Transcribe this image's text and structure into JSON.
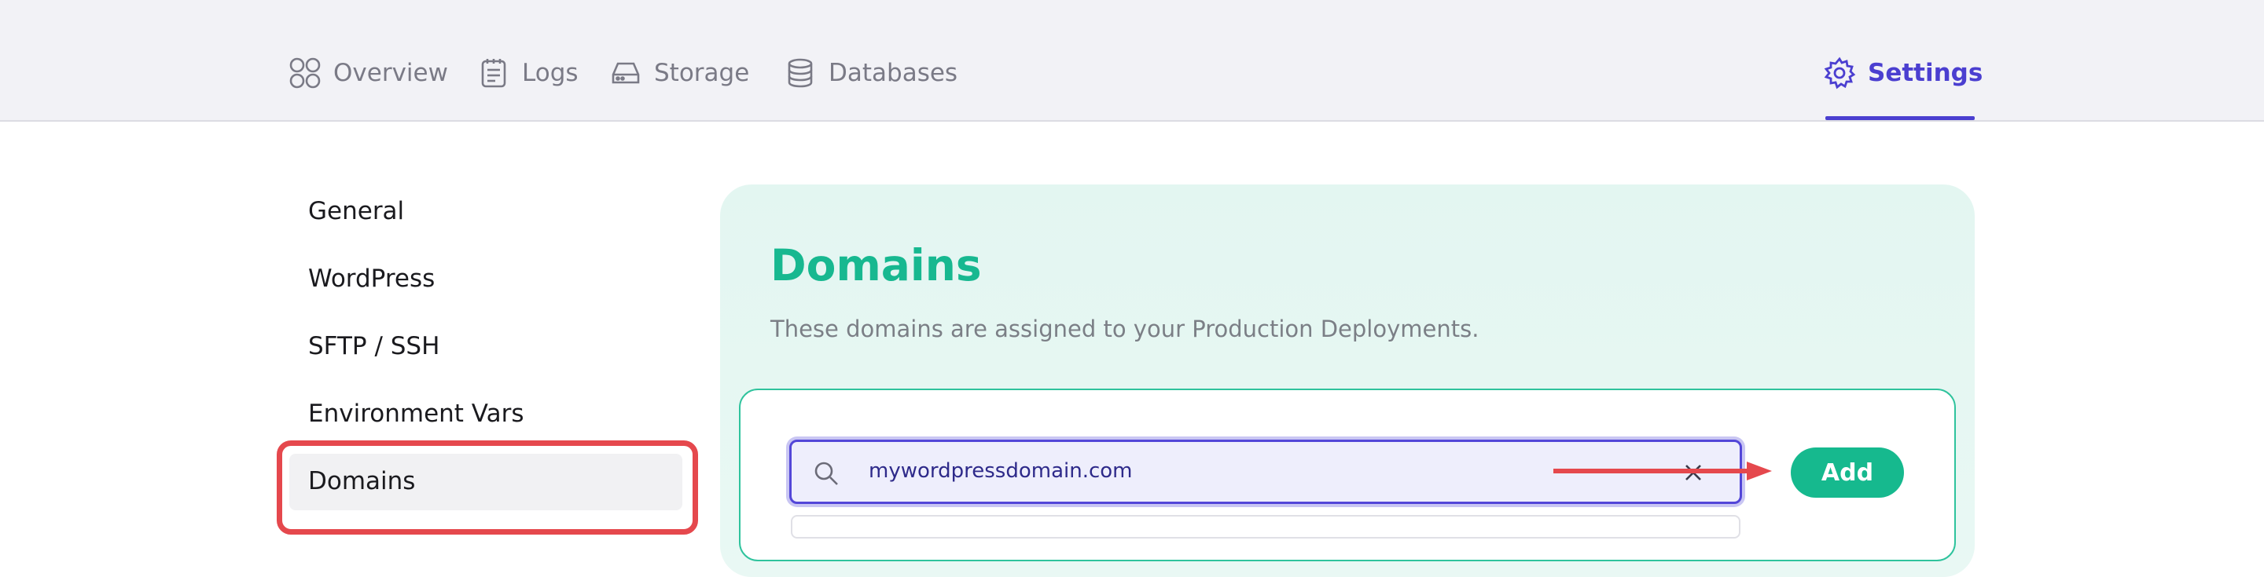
{
  "nav": {
    "tabs": [
      {
        "label": "Overview",
        "icon": "overview-icon"
      },
      {
        "label": "Logs",
        "icon": "logs-icon"
      },
      {
        "label": "Storage",
        "icon": "storage-icon"
      },
      {
        "label": "Databases",
        "icon": "databases-icon"
      }
    ],
    "settings": {
      "label": "Settings",
      "icon": "gear-icon",
      "active": true
    }
  },
  "sidebar": {
    "items": [
      {
        "label": "General"
      },
      {
        "label": "WordPress"
      },
      {
        "label": "SFTP / SSH"
      },
      {
        "label": "Environment Vars"
      },
      {
        "label": "Domains",
        "active": true
      }
    ]
  },
  "panel": {
    "title": "Domains",
    "subtitle": "These domains are assigned to your Production Deployments.",
    "domain_input": {
      "value": "mywordpressdomain.com"
    },
    "add_label": "Add"
  },
  "colors": {
    "accent": "#4b3fd0",
    "brand_green": "#16b98e",
    "highlight_red": "#e5484d"
  }
}
